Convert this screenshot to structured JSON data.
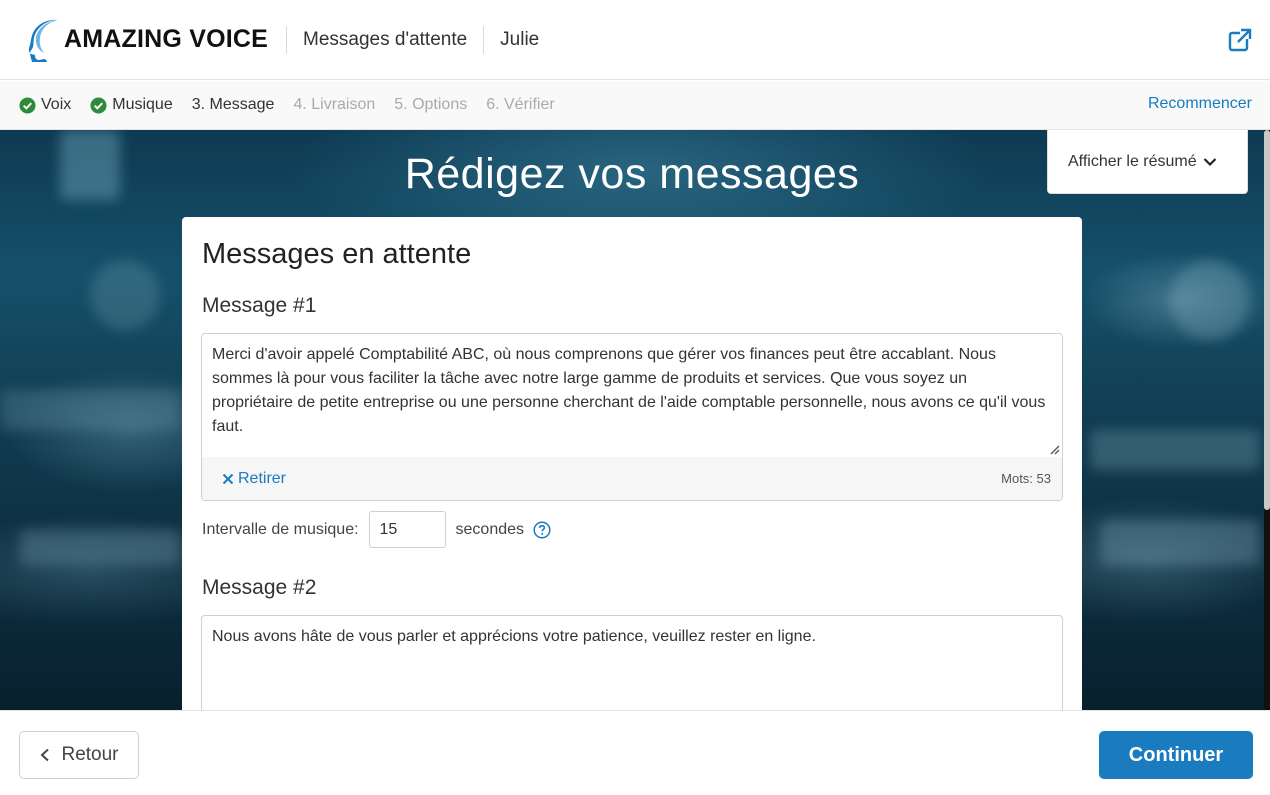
{
  "header": {
    "brand": "AMAZING VOICE",
    "product": "Messages d'attente",
    "voice_name": "Julie",
    "external_link_icon": "external-link-icon"
  },
  "stepper": {
    "steps": [
      {
        "label": "Voix",
        "state": "done"
      },
      {
        "label": "Musique",
        "state": "done"
      },
      {
        "label": "3. Message",
        "state": "active"
      },
      {
        "label": "4. Livraison",
        "state": "todo"
      },
      {
        "label": "5. Options",
        "state": "todo"
      },
      {
        "label": "6. Vérifier",
        "state": "todo"
      }
    ],
    "restart_label": "Recommencer"
  },
  "hero": {
    "title": "Rédigez vos messages",
    "summary_label": "Afficher le résumé"
  },
  "card": {
    "title": "Messages en attente",
    "messages": [
      {
        "label": "Message #1",
        "text": "Merci d'avoir appelé Comptabilité ABC, où nous comprenons que gérer vos finances peut être accablant. Nous sommes là pour vous faciliter la tâche avec notre large gamme de produits et services. Que vous soyez un propriétaire de petite entreprise ou une personne cherchant de l'aide comptable personnelle, nous avons ce qu'il vous faut.",
        "remove_label": "Retirer",
        "word_count": "Mots: 53"
      },
      {
        "label": "Message #2",
        "text": "Nous avons hâte de vous parler et apprécions votre patience, veuillez rester en ligne."
      }
    ],
    "interval": {
      "label": "Intervalle de musique:",
      "value": "15",
      "unit": "secondes"
    }
  },
  "footer": {
    "back_label": "Retour",
    "continue_label": "Continuer"
  },
  "colors": {
    "accent": "#1a7bbf",
    "success": "#2e8b3a"
  }
}
